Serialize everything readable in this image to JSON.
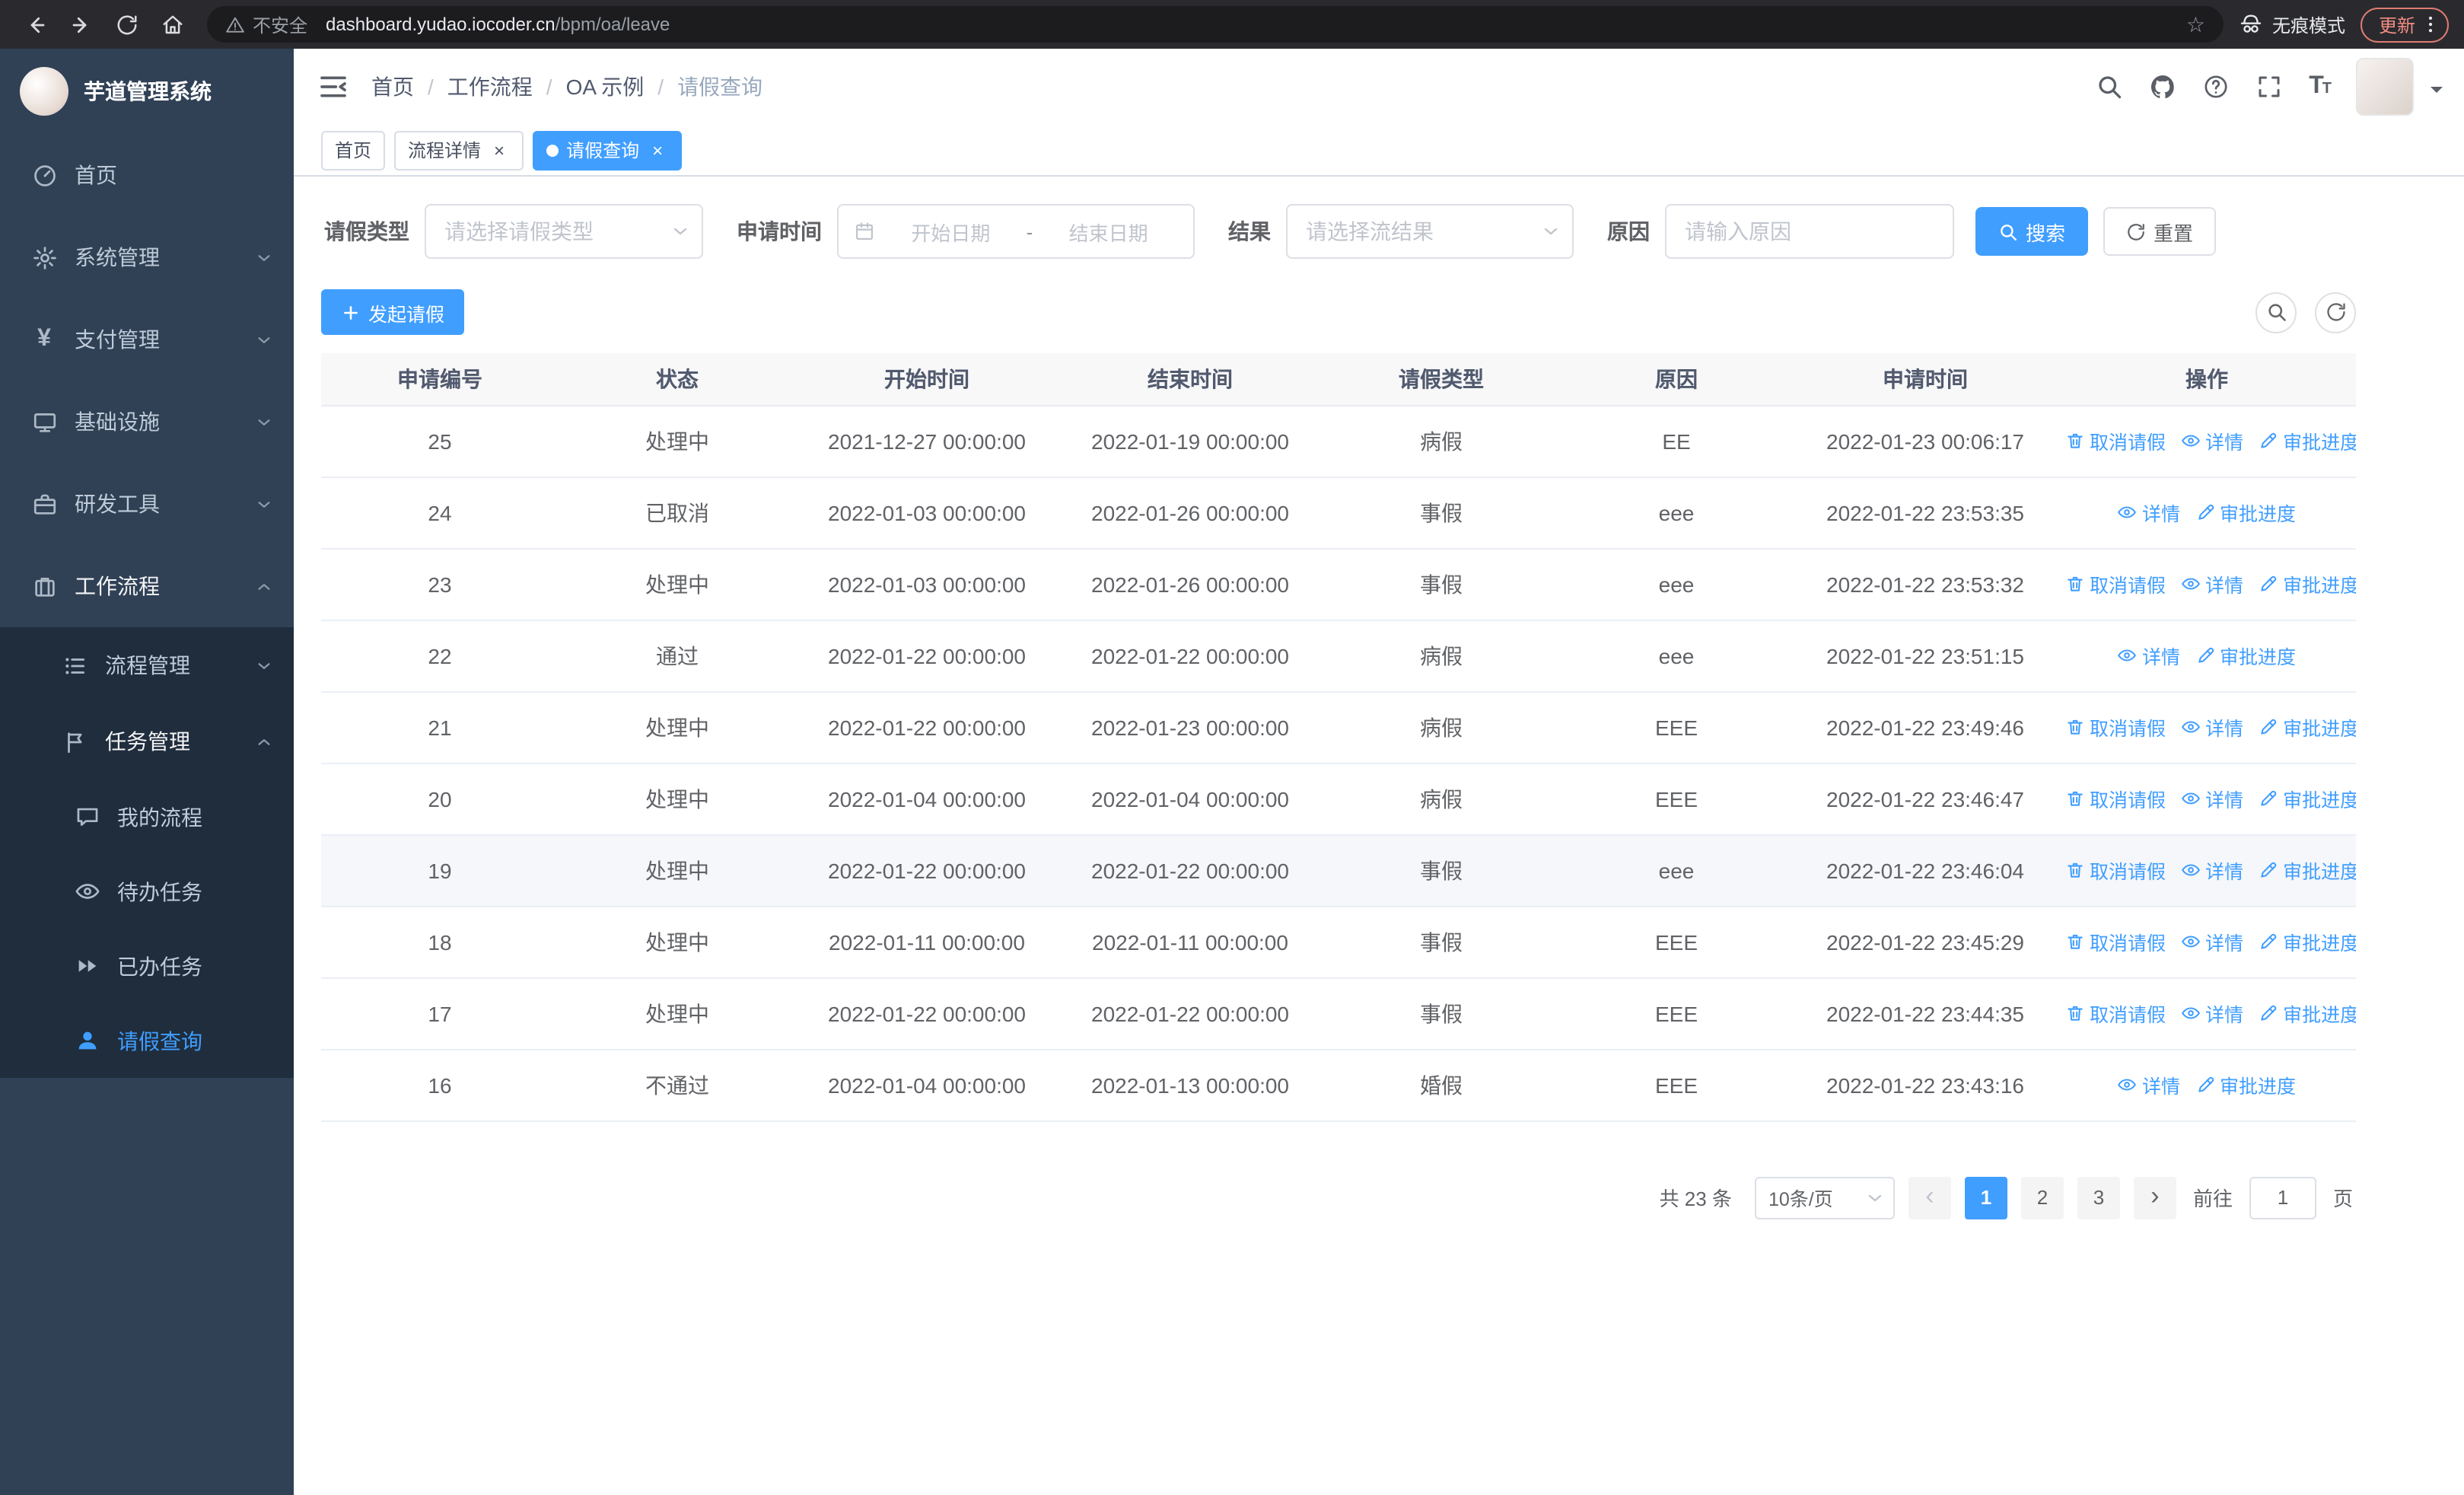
{
  "browser": {
    "security_label": "不安全",
    "url_host": "dashboard.yudao.iocoder.cn",
    "url_path": "/bpm/oa/leave",
    "incognito_label": "无痕模式",
    "update_label": "更新"
  },
  "sidebar": {
    "logo_title": "芋道管理系统",
    "items": {
      "home": "首页",
      "system": "系统管理",
      "payment": "支付管理",
      "infra": "基础设施",
      "devtools": "研发工具",
      "workflow": "工作流程",
      "process_mgmt": "流程管理",
      "task_mgmt": "任务管理",
      "my_process": "我的流程",
      "todo_tasks": "待办任务",
      "done_tasks": "已办任务",
      "leave_query": "请假查询"
    }
  },
  "navbar": {
    "breadcrumb": [
      "首页",
      "工作流程",
      "OA 示例",
      "请假查询"
    ],
    "breadcrumb_separator": "/"
  },
  "tabs": [
    {
      "label": "首页"
    },
    {
      "label": "流程详情"
    },
    {
      "label": "请假查询"
    }
  ],
  "filters": {
    "leave_type_label": "请假类型",
    "leave_type_placeholder": "请选择请假类型",
    "apply_time_label": "申请时间",
    "start_date_placeholder": "开始日期",
    "range_separator": "-",
    "end_date_placeholder": "结束日期",
    "result_label": "结果",
    "result_placeholder": "请选择流结果",
    "reason_label": "原因",
    "reason_placeholder": "请输入原因",
    "search_label": "搜索",
    "reset_label": "重置"
  },
  "toolbar": {
    "create_label": "发起请假"
  },
  "table": {
    "columns": [
      "申请编号",
      "状态",
      "开始时间",
      "结束时间",
      "请假类型",
      "原因",
      "申请时间",
      "操作"
    ],
    "action_labels": {
      "cancel": "取消请假",
      "detail": "详情",
      "progress": "审批进度"
    },
    "rows": [
      {
        "id": "25",
        "status": "处理中",
        "start": "2021-12-27 00:00:00",
        "end": "2022-01-19 00:00:00",
        "type": "病假",
        "reason": "EE",
        "applied": "2022-01-23 00:06:17",
        "can_cancel": true,
        "highlighted": false
      },
      {
        "id": "24",
        "status": "已取消",
        "start": "2022-01-03 00:00:00",
        "end": "2022-01-26 00:00:00",
        "type": "事假",
        "reason": "eee",
        "applied": "2022-01-22 23:53:35",
        "can_cancel": false,
        "highlighted": false
      },
      {
        "id": "23",
        "status": "处理中",
        "start": "2022-01-03 00:00:00",
        "end": "2022-01-26 00:00:00",
        "type": "事假",
        "reason": "eee",
        "applied": "2022-01-22 23:53:32",
        "can_cancel": true,
        "highlighted": false
      },
      {
        "id": "22",
        "status": "通过",
        "start": "2022-01-22 00:00:00",
        "end": "2022-01-22 00:00:00",
        "type": "病假",
        "reason": "eee",
        "applied": "2022-01-22 23:51:15",
        "can_cancel": false,
        "highlighted": false
      },
      {
        "id": "21",
        "status": "处理中",
        "start": "2022-01-22 00:00:00",
        "end": "2022-01-23 00:00:00",
        "type": "病假",
        "reason": "EEE",
        "applied": "2022-01-22 23:49:46",
        "can_cancel": true,
        "highlighted": false
      },
      {
        "id": "20",
        "status": "处理中",
        "start": "2022-01-04 00:00:00",
        "end": "2022-01-04 00:00:00",
        "type": "病假",
        "reason": "EEE",
        "applied": "2022-01-22 23:46:47",
        "can_cancel": true,
        "highlighted": false
      },
      {
        "id": "19",
        "status": "处理中",
        "start": "2022-01-22 00:00:00",
        "end": "2022-01-22 00:00:00",
        "type": "事假",
        "reason": "eee",
        "applied": "2022-01-22 23:46:04",
        "can_cancel": true,
        "highlighted": true
      },
      {
        "id": "18",
        "status": "处理中",
        "start": "2022-01-11 00:00:00",
        "end": "2022-01-11 00:00:00",
        "type": "事假",
        "reason": "EEE",
        "applied": "2022-01-22 23:45:29",
        "can_cancel": true,
        "highlighted": false
      },
      {
        "id": "17",
        "status": "处理中",
        "start": "2022-01-22 00:00:00",
        "end": "2022-01-22 00:00:00",
        "type": "事假",
        "reason": "EEE",
        "applied": "2022-01-22 23:44:35",
        "can_cancel": true,
        "highlighted": false
      },
      {
        "id": "16",
        "status": "不通过",
        "start": "2022-01-04 00:00:00",
        "end": "2022-01-13 00:00:00",
        "type": "婚假",
        "reason": "EEE",
        "applied": "2022-01-22 23:43:16",
        "can_cancel": false,
        "highlighted": false
      }
    ]
  },
  "pagination": {
    "total_text": "共 23 条",
    "page_size": "10条/页",
    "pages": [
      "1",
      "2",
      "3"
    ],
    "current_page": "1",
    "goto_prefix": "前往",
    "goto_value": "1",
    "goto_suffix": "页"
  },
  "colors": {
    "primary": "#409eff",
    "sidebar_bg": "#304156",
    "submenu_bg": "#1f2d3d",
    "chrome_bg": "#2a2a2e",
    "update_accent": "#ef8b81"
  }
}
